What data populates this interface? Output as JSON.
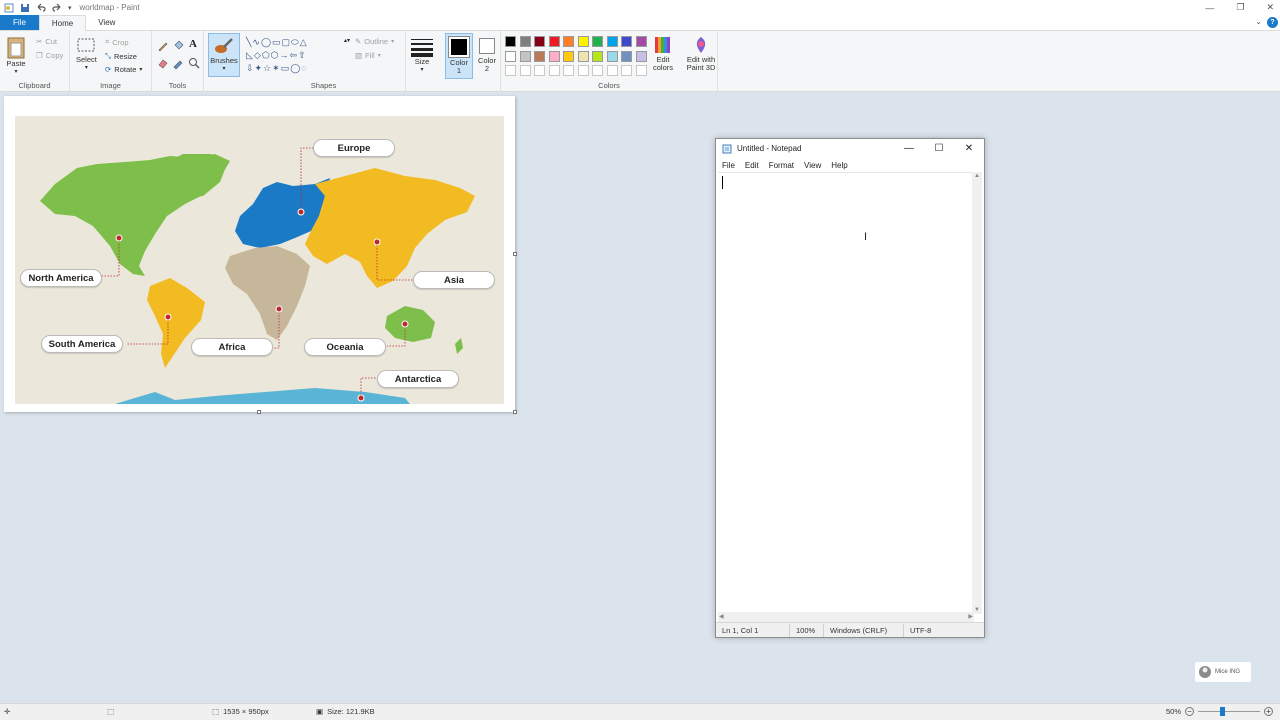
{
  "window": {
    "title": "worldmap - Paint",
    "file_tab": "File",
    "tabs": [
      "Home",
      "View"
    ],
    "help": "?"
  },
  "ribbon": {
    "clipboard": {
      "paste": "Paste",
      "cut": "Cut",
      "copy": "Copy",
      "label": "Clipboard"
    },
    "image": {
      "select": "Select",
      "crop": "Crop",
      "resize": "Resize",
      "rotate": "Rotate",
      "label": "Image"
    },
    "tools": {
      "label": "Tools"
    },
    "brushes": {
      "label": "Brushes"
    },
    "shapes": {
      "outline": "Outline",
      "fill": "Fill",
      "label": "Shapes"
    },
    "size": {
      "label": "Size"
    },
    "color1": {
      "label": "Color\n1"
    },
    "color2": {
      "label": "Color\n2"
    },
    "colors": {
      "label": "Colors",
      "edit": "Edit colors",
      "paint3d": "Edit with Paint 3D"
    },
    "palette_row1": [
      "#000000",
      "#7f7f7f",
      "#880015",
      "#ed1c24",
      "#ff7f27",
      "#fff200",
      "#22b14c",
      "#00a2e8",
      "#3f48cc",
      "#a349a4"
    ],
    "palette_row2": [
      "#ffffff",
      "#c3c3c3",
      "#b97a57",
      "#ffaec9",
      "#ffc90e",
      "#efe4b0",
      "#b5e61d",
      "#99d9ea",
      "#7092be",
      "#c8bfe7"
    ],
    "palette_row3": [
      "#ffffff",
      "#ffffff",
      "#ffffff",
      "#ffffff",
      "#ffffff",
      "#ffffff",
      "#ffffff",
      "#ffffff",
      "#ffffff",
      "#ffffff"
    ]
  },
  "map": {
    "labels": {
      "europe": "Europe",
      "north_america": "North America",
      "asia": "Asia",
      "south_america": "South America",
      "africa": "Africa",
      "oceania": "Oceania",
      "antarctica": "Antarctica"
    },
    "colors": {
      "north_america": "#7dbf4a",
      "europe": "#1a7ac6",
      "asia": "#f3bb22",
      "africa": "#c7b79a",
      "south_america": "#f3bb22",
      "oceania": "#7dbf4a",
      "antarctica": "#5ab4d6",
      "marker": "#c0272d"
    }
  },
  "notepad": {
    "title": "Untitled - Notepad",
    "menu": [
      "File",
      "Edit",
      "Format",
      "View",
      "Help"
    ],
    "status": {
      "position": "Ln 1, Col 1",
      "zoom": "100%",
      "line_ending": "Windows (CRLF)",
      "encoding": "UTF-8"
    }
  },
  "statusbar": {
    "dimensions": "1535 × 950px",
    "size": "Size: 121.9KB",
    "zoom": "50%"
  },
  "watermark": {
    "text": "Mice ING"
  }
}
